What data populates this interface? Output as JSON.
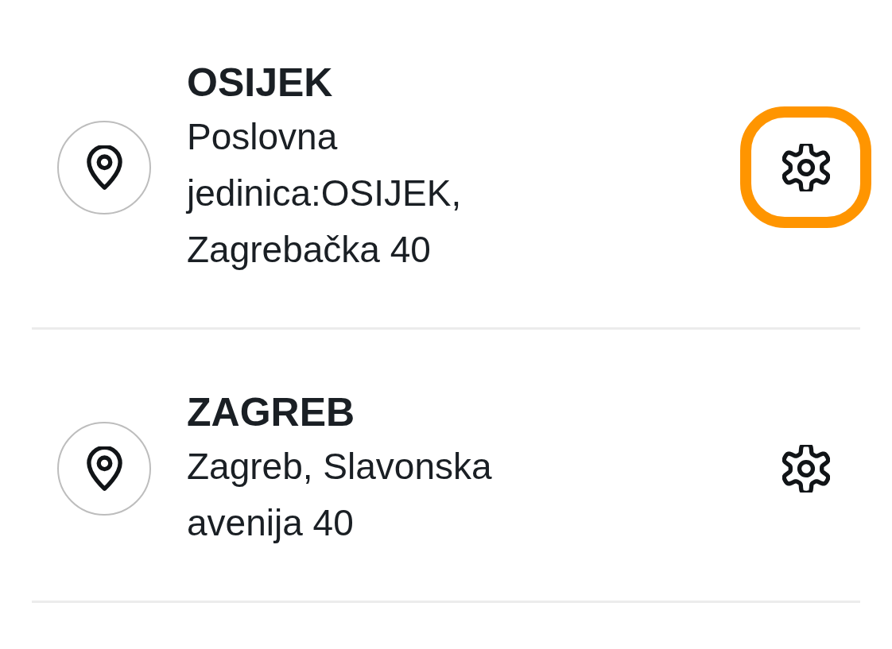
{
  "locations": [
    {
      "name": "OSIJEK",
      "address": "Poslovna jedinica:OSIJEK, Zagrebačka 40",
      "highlighted": true
    },
    {
      "name": "ZAGREB",
      "address": "Zagreb, Slavonska avenija 40",
      "highlighted": false
    }
  ]
}
